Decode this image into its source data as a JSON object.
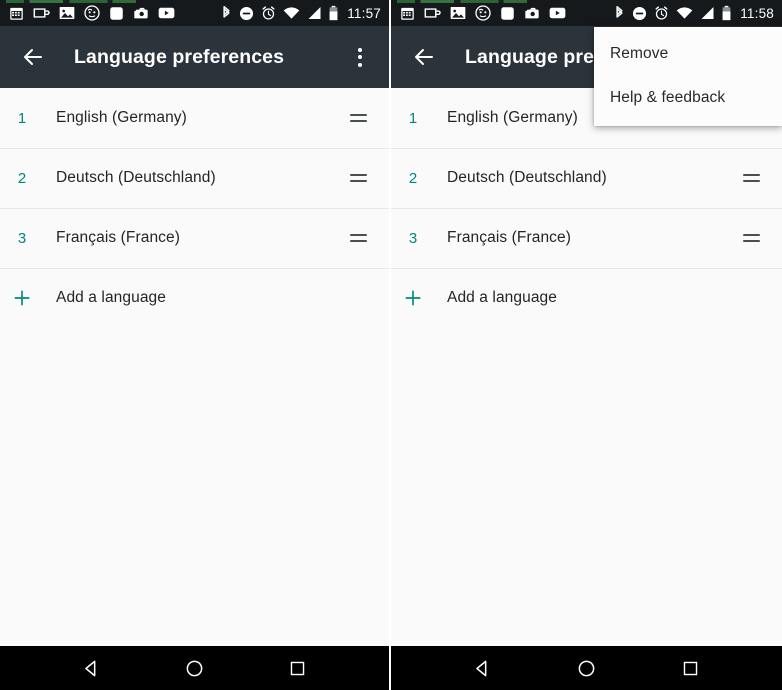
{
  "app": {
    "title": "Language preferences",
    "title_truncated": "Language prefe",
    "accent_color": "#00897b",
    "appbar_color": "#2b343b",
    "background_color": "#fafafa",
    "statusbar_color": "#15191c",
    "navbar_color": "#000000"
  },
  "status_bar_left": {
    "time": "11:57",
    "time_right": "11:58",
    "icons": [
      "calendar-icon",
      "coffee-mug-icon",
      "photo-icon",
      "face-emoji-icon",
      "rounded-square-icon",
      "camera-icon",
      "youtube-icon"
    ],
    "system_icons": [
      "bluetooth-icon",
      "do-not-disturb-icon",
      "alarm-clock-icon",
      "wifi-icon",
      "signal-icon",
      "battery-icon"
    ]
  },
  "toolbar": {
    "back_icon": "arrow-back-icon",
    "overflow_icon": "more-vert-icon"
  },
  "languages": [
    {
      "num": "1",
      "label": "English (Germany)",
      "handle": "drag-handle-icon"
    },
    {
      "num": "2",
      "label": "Deutsch (Deutschland)",
      "handle": "drag-handle-icon"
    },
    {
      "num": "3",
      "label": "Français (France)",
      "handle": "drag-handle-icon"
    }
  ],
  "add_row": {
    "icon": "plus-icon",
    "label": "Add a language"
  },
  "overflow_menu": {
    "items": [
      {
        "label": "Remove"
      },
      {
        "label": "Help & feedback"
      }
    ]
  },
  "nav_bar": {
    "back": "nav-back-triangle-icon",
    "home": "nav-home-circle-icon",
    "recents": "nav-recents-square-icon"
  }
}
